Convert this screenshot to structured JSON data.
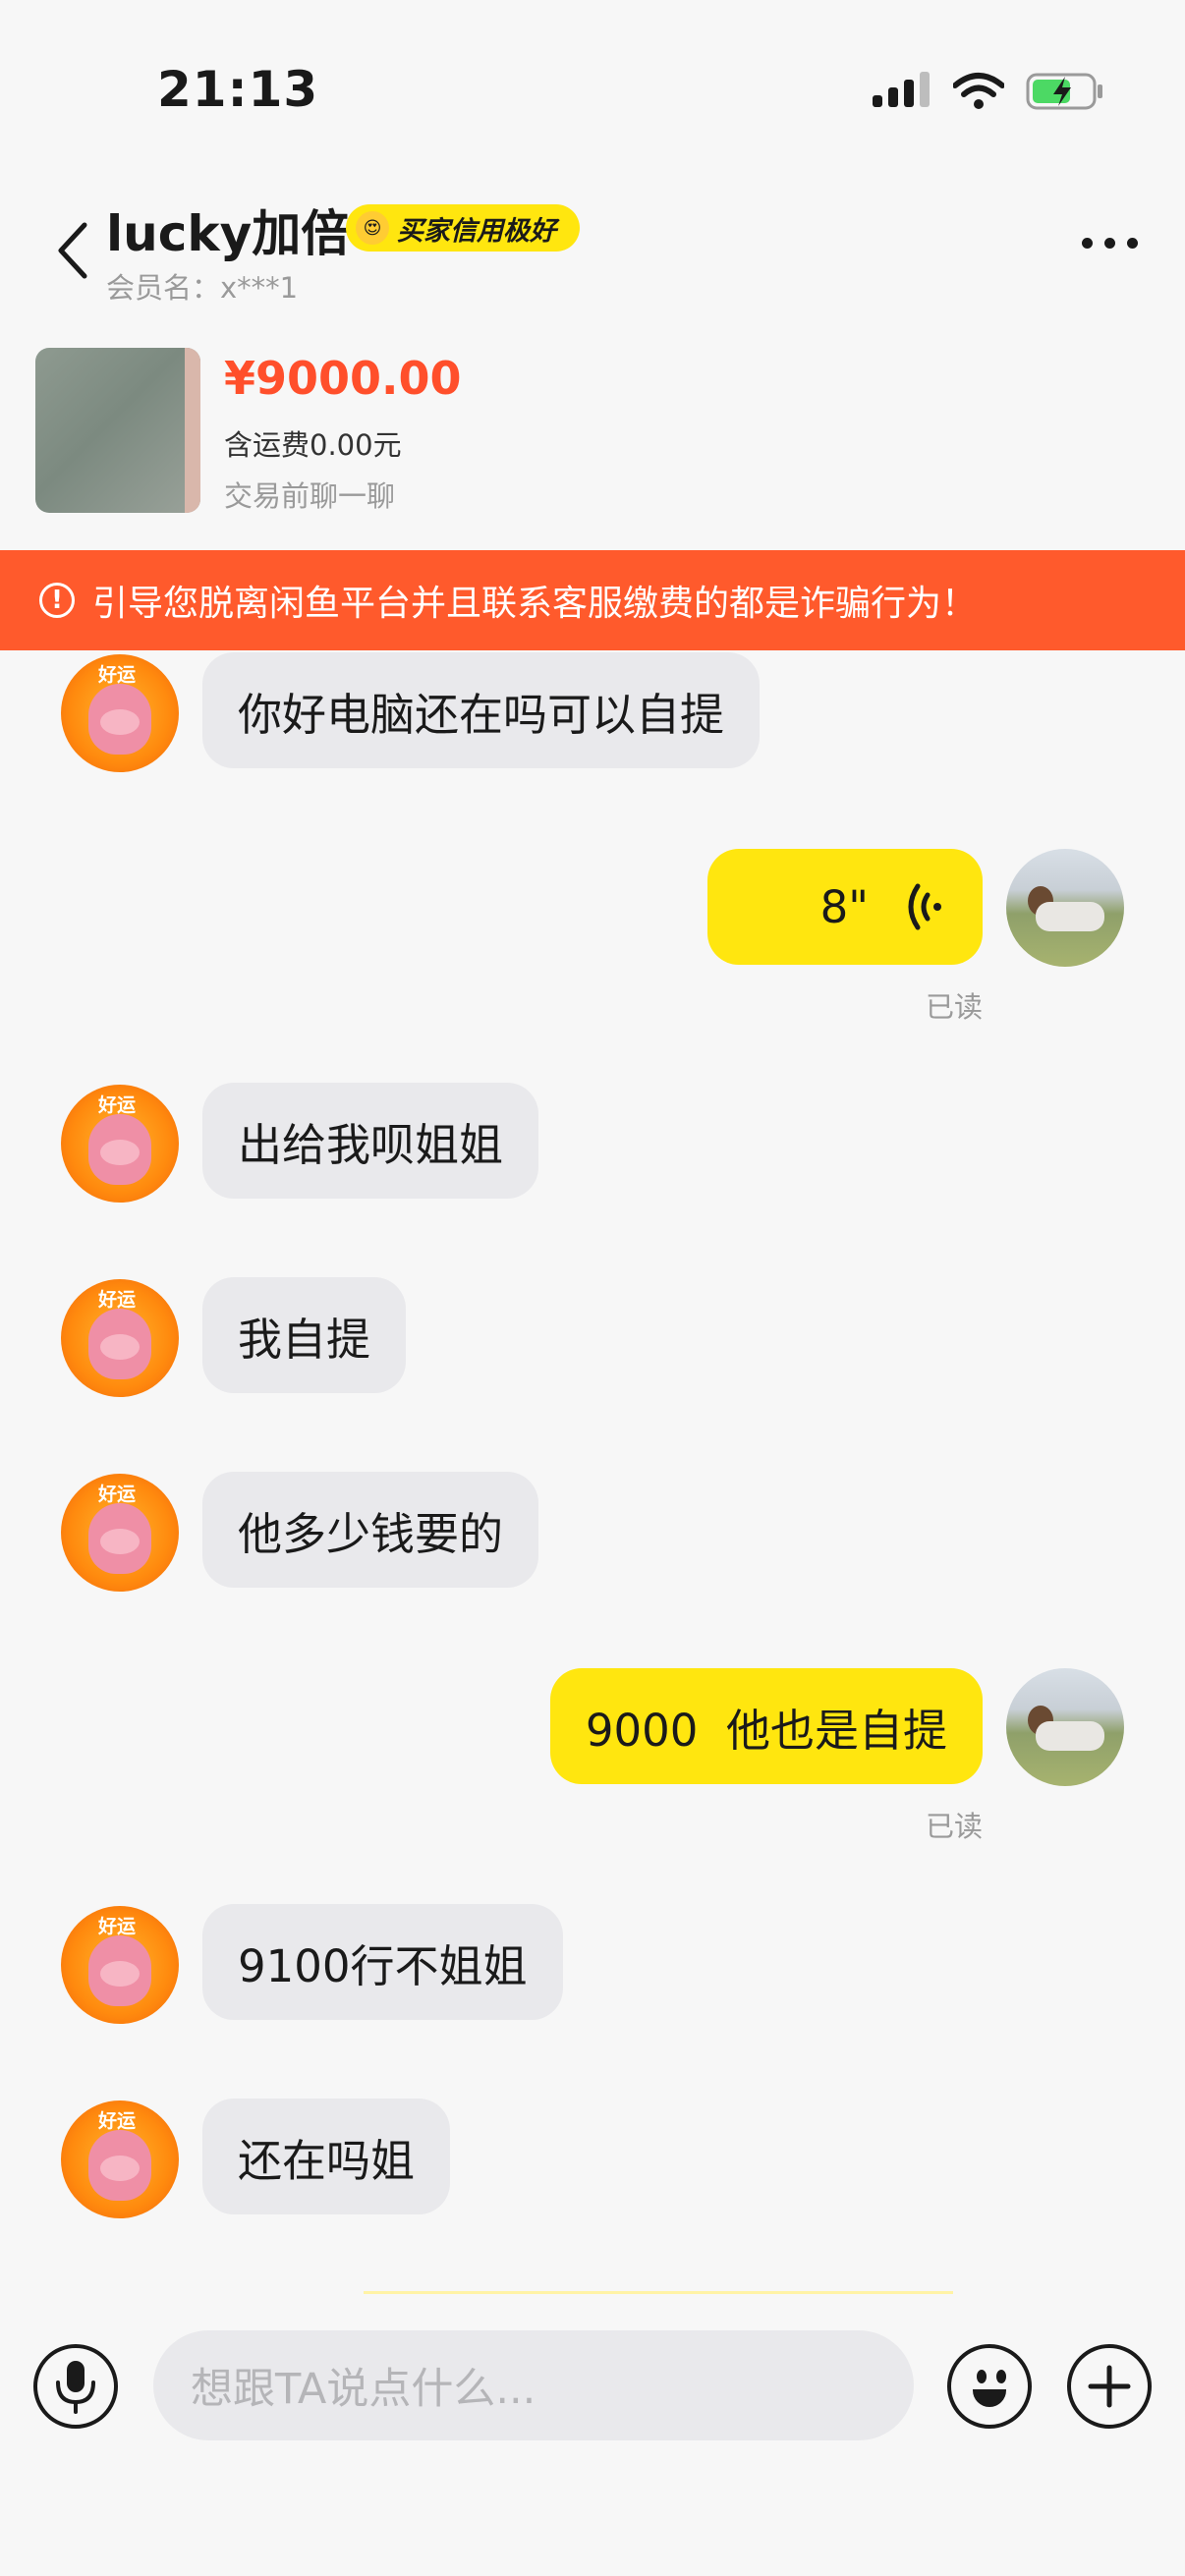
{
  "status_bar": {
    "time": "21:13"
  },
  "header": {
    "title": "lucky加倍",
    "badge": "买家信用极好",
    "member_label": "会员名：x***1"
  },
  "product": {
    "price": "¥9000.00",
    "shipping": "含运费0.00元",
    "chat_prompt": "交易前聊一聊"
  },
  "warning": {
    "text": "引导您脱离闲鱼平台并且联系客服缴费的都是诈骗行为！"
  },
  "messages": [
    {
      "sender": "other",
      "text": "你好电脑还在吗可以自提"
    },
    {
      "sender": "self",
      "type": "voice",
      "text": "8\"",
      "read": "已读"
    },
    {
      "sender": "other",
      "text": "出给我呗姐姐"
    },
    {
      "sender": "other",
      "text": "我自提"
    },
    {
      "sender": "other",
      "text": "他多少钱要的"
    },
    {
      "sender": "self",
      "text": "9000  他也是自提",
      "read": "已读"
    },
    {
      "sender": "other",
      "text": "9100行不姐姐"
    },
    {
      "sender": "other",
      "text": "还在吗姐"
    }
  ],
  "input": {
    "placeholder": "想跟TA说点什么..."
  },
  "colors": {
    "accent_yellow": "#ffe60f",
    "warning_red": "#ff5a2c",
    "price_red": "#ff4f2b"
  }
}
